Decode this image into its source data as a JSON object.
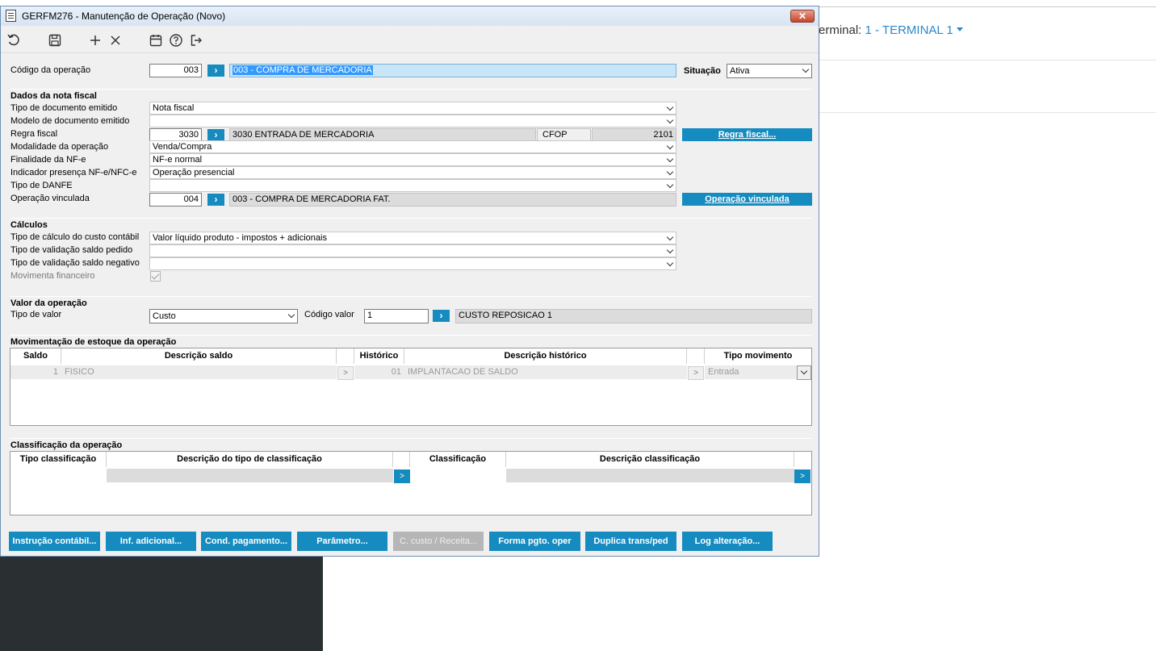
{
  "background": {
    "terminal_label": "erminal: ",
    "terminal_value": "1 - TERMINAL 1"
  },
  "window": {
    "title": "GERFM276 - Manutenção de Operação (Novo)",
    "close_glyph": "✕"
  },
  "toolbar": {
    "icons": [
      "refresh-icon",
      "save-icon",
      "add-icon",
      "delete-icon",
      "calendar-icon",
      "help-icon",
      "exit-icon"
    ]
  },
  "header": {
    "codigo_label": "Código da operação",
    "codigo_value": "003",
    "descricao_value": "003 - COMPRA DE MERCADORIA",
    "situacao_label": "Situação",
    "situacao_value": "Ativa"
  },
  "nota_fiscal": {
    "section_title": "Dados da nota fiscal",
    "tipo_documento_label": "Tipo de documento emitido",
    "tipo_documento_value": "Nota fiscal",
    "modelo_documento_label": "Modelo de documento emitido",
    "modelo_documento_value": "",
    "regra_fiscal_label": "Regra fiscal",
    "regra_fiscal_code": "3030",
    "regra_fiscal_desc": "3030 ENTRADA DE MERCADORIA",
    "cfop_label": "CFOP",
    "cfop_value": "2101",
    "regra_fiscal_button": "Regra fiscal...",
    "modalidade_label": "Modalidade da operação",
    "modalidade_value": "Venda/Compra",
    "finalidade_label": "Finalidade da NF-e",
    "finalidade_value": "NF-e normal",
    "indicador_label": "Indicador presença NF-e/NFC-e",
    "indicador_value": "Operação presencial",
    "tipo_danfe_label": "Tipo de DANFE",
    "tipo_danfe_value": "",
    "op_vinculada_label": "Operação vinculada",
    "op_vinculada_code": "004",
    "op_vinculada_desc": "003 - COMPRA DE MERCADORIA FAT.",
    "op_vinculada_button": "Operação vinculada"
  },
  "calculos": {
    "section_title": "Cálculos",
    "custo_contabil_label": "Tipo de cálculo do custo contábil",
    "custo_contabil_value": "Valor líquido produto - impostos + adicionais",
    "saldo_pedido_label": "Tipo de validação saldo pedido",
    "saldo_pedido_value": "",
    "saldo_negativo_label": "Tipo de validação saldo negativo",
    "saldo_negativo_value": "",
    "movimenta_label": "Movimenta financeiro"
  },
  "valor": {
    "section_title": "Valor da operação",
    "tipo_valor_label": "Tipo de valor",
    "tipo_valor_value": "Custo",
    "codigo_valor_label": "Código valor",
    "codigo_valor_value": "1",
    "codigo_valor_desc": "CUSTO REPOSICAO 1"
  },
  "estoque": {
    "section_title": "Movimentação de estoque da operação",
    "columns": [
      "Saldo",
      "Descrição saldo",
      "Histórico",
      "Descrição histórico",
      "Tipo movimento"
    ],
    "rows": [
      {
        "saldo": "1",
        "descricao_saldo": "FISICO",
        "historico": "01",
        "descricao_historico": "IMPLANTACAO DE SALDO",
        "tipo_movimento": "Entrada"
      }
    ]
  },
  "classificacao": {
    "section_title": "Classificação da operação",
    "columns": [
      "Tipo classificação",
      "Descrição do tipo de classificação",
      "Classificação",
      "Descrição classificação"
    ]
  },
  "bottom_buttons": [
    {
      "label": "Instrução contábil...",
      "enabled": true
    },
    {
      "label": "Inf. adicional...",
      "enabled": true
    },
    {
      "label": "Cond. pagamento...",
      "enabled": true
    },
    {
      "label": "Parâmetro...",
      "enabled": true
    },
    {
      "label": "C. custo / Receita...",
      "enabled": false
    },
    {
      "label": "Forma pgto. oper",
      "enabled": true
    },
    {
      "label": "Duplica trans/ped",
      "enabled": true
    },
    {
      "label": "Log alteração...",
      "enabled": true
    }
  ],
  "colors": {
    "accent": "#168bc0",
    "highlight_field": "#c7e6f7",
    "dark_panel": "#2a2f31"
  }
}
